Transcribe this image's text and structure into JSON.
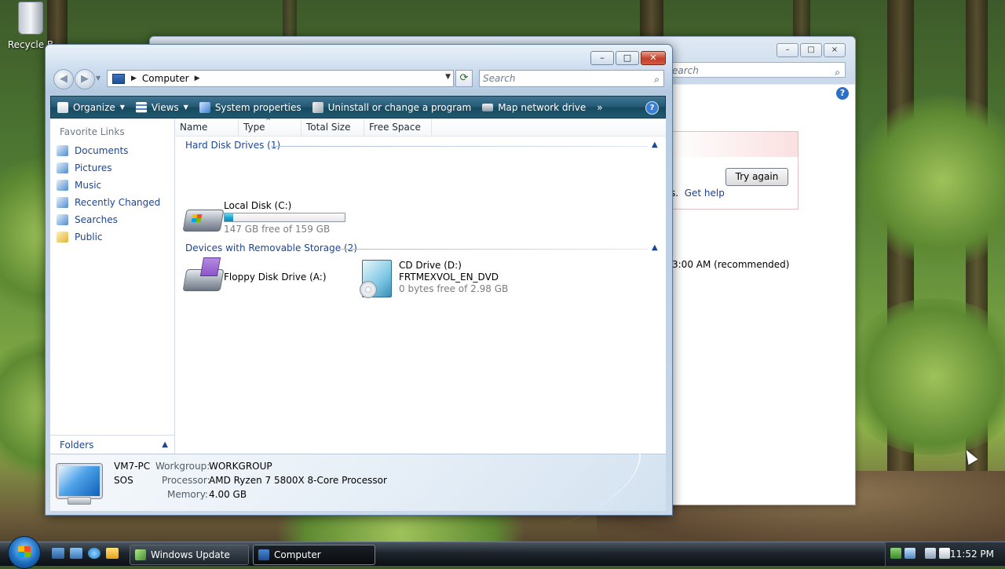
{
  "desktop": {
    "recycle_bin_label": "Recycle B"
  },
  "back_window": {
    "title": "Windows Update",
    "search_placeholder": "earch",
    "try_again_label": "Try again",
    "get_help_prefix": "s.",
    "get_help_label": "Get help",
    "schedule_text": "3:00 AM (recommended)"
  },
  "window": {
    "title": "Computer",
    "address": {
      "location": "Computer"
    },
    "search": {
      "placeholder": "Search"
    },
    "toolbar": {
      "organize": "Organize",
      "views": "Views",
      "system_properties": "System properties",
      "uninstall": "Uninstall or change a program",
      "map_drive": "Map network drive",
      "more": "»",
      "help": "?"
    },
    "favorites": {
      "title": "Favorite Links",
      "items": [
        {
          "label": "Documents",
          "icon": "documents-icon"
        },
        {
          "label": "Pictures",
          "icon": "pictures-icon"
        },
        {
          "label": "Music",
          "icon": "music-icon"
        },
        {
          "label": "Recently Changed",
          "icon": "recently-changed-icon"
        },
        {
          "label": "Searches",
          "icon": "searches-icon"
        },
        {
          "label": "Public",
          "icon": "public-folder-icon"
        }
      ],
      "folders_label": "Folders"
    },
    "columns": [
      "Name",
      "Type",
      "Total Size",
      "Free Space"
    ],
    "groups": {
      "hdd": {
        "label": "Hard Disk Drives (1)",
        "drives": [
          {
            "name": "Local Disk (C:)",
            "subtitle": "147 GB free of 159 GB",
            "used_fraction": 0.075,
            "bar_color": "#1ea3cf"
          }
        ]
      },
      "removable": {
        "label": "Devices with Removable Storage (2)",
        "drives": [
          {
            "name": "Floppy Disk Drive (A:)"
          },
          {
            "name": "CD Drive (D:)",
            "label2": "FRTMEXVOL_EN_DVD",
            "subtitle": "0 bytes free of 2.98 GB"
          }
        ]
      }
    },
    "details": {
      "pc_name": "VM7-PC",
      "pc_desc": "SOS",
      "workgroup_label": "Workgroup:",
      "workgroup": "WORKGROUP",
      "processor_label": "Processor:",
      "processor": "AMD Ryzen 7 5800X 8-Core Processor",
      "memory_label": "Memory:",
      "memory": "4.00 GB"
    }
  },
  "taskbar": {
    "tasks": [
      {
        "label": "Windows Update",
        "active": false
      },
      {
        "label": "Computer",
        "active": true
      }
    ],
    "clock": "11:52 PM"
  },
  "colors": {
    "accent": "#1a4696",
    "toolbar": "#245a76",
    "close": "#c2402a"
  }
}
